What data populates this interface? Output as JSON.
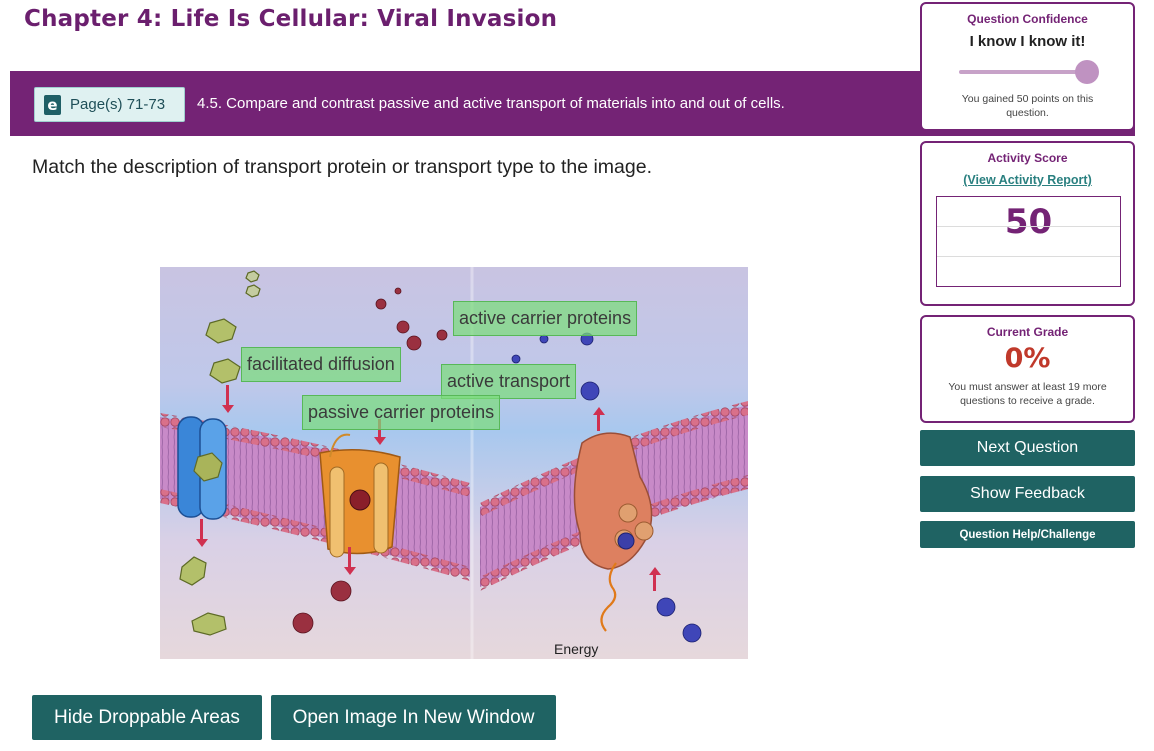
{
  "header": {
    "chapter_title": "Chapter 4: Life Is Cellular: Viral Invasion"
  },
  "objective": {
    "pages_label": "Page(s) 71-73",
    "text": "4.5. Compare and contrast passive and active transport of materials into and out of cells."
  },
  "question": {
    "prompt": "Match the description of transport protein or transport type to the image.",
    "image_caption_energy": "Energy"
  },
  "drop_labels": [
    {
      "text": "active carrier proteins"
    },
    {
      "text": "facilitated diffusion"
    },
    {
      "text": "active transport"
    },
    {
      "text": "passive carrier proteins"
    }
  ],
  "buttons": {
    "hide_droppable": "Hide Droppable Areas",
    "open_image": "Open Image In New Window",
    "next_question": "Next Question",
    "show_feedback": "Show Feedback",
    "help_challenge": "Question Help/Challenge"
  },
  "confidence": {
    "title": "Question Confidence",
    "value": "I know I know it!",
    "level": 1.0,
    "note": "You gained 50 points on this question."
  },
  "activity": {
    "title": "Activity Score",
    "report_link": "(View Activity Report)",
    "score": "50"
  },
  "grade": {
    "title": "Current Grade",
    "value": "0%",
    "note": "You must answer at least 19 more questions to receive a grade."
  },
  "colors": {
    "purple": "#742375",
    "teal_button": "#1f6363",
    "grade_red": "#c0392b",
    "label_green": "#7cdc7c"
  },
  "icons": {
    "page_badge": "ebook-icon"
  }
}
